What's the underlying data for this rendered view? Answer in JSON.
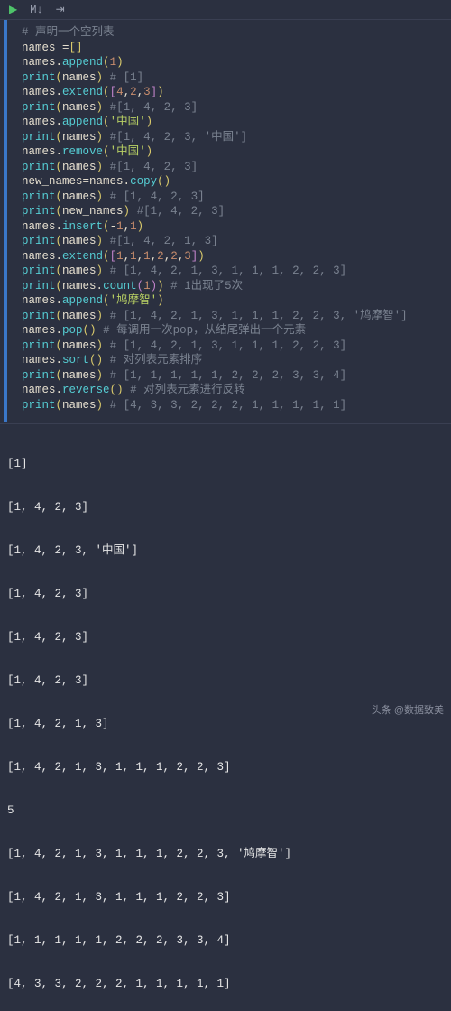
{
  "toolbar": {
    "run": "▶",
    "markdown": "M↓",
    "more": "⇥"
  },
  "code": {
    "l1": {
      "c": "# 声明一个空列表"
    },
    "l2": {
      "v1": "names ",
      "op": "=",
      "br1": "[",
      "br2": "]"
    },
    "l3": {
      "v1": "names",
      "dot": ".",
      "fn": "append",
      "p1": "(",
      "n1": "1",
      "p2": ")"
    },
    "l4": {
      "fn": "print",
      "p1": "(",
      "v1": "names",
      "p2": ")",
      "sp": " ",
      "c": "# [1]"
    },
    "l5": {
      "v1": "names",
      "dot": ".",
      "fn": "extend",
      "p1": "(",
      "b21": "[",
      "n1": "4",
      "c1": ",",
      "n2": "2",
      "c2": ",",
      "n3": "3",
      "b22": "]",
      "p2": ")"
    },
    "l6": {
      "fn": "print",
      "p1": "(",
      "v1": "names",
      "p2": ")",
      "sp": " ",
      "c": "#[1, 4, 2, 3]"
    },
    "l7": {
      "v1": "names",
      "dot": ".",
      "fn": "append",
      "p1": "(",
      "s1": "'中国'",
      "p2": ")"
    },
    "l8": {
      "fn": "print",
      "p1": "(",
      "v1": "names",
      "p2": ")",
      "sp": " ",
      "c": "#[1, 4, 2, 3, '中国']"
    },
    "l9": {
      "v1": "names",
      "dot": ".",
      "fn": "remove",
      "p1": "(",
      "s1": "'中国'",
      "p2": ")"
    },
    "l10": {
      "fn": "print",
      "p1": "(",
      "v1": "names",
      "p2": ")",
      "sp": " ",
      "c": "#[1, 4, 2, 3]"
    },
    "l11": {
      "v1": "new_names",
      "op": "=",
      "v2": "names",
      "dot": ".",
      "fn": "copy",
      "p1": "(",
      "p2": ")"
    },
    "l12": {
      "fn": "print",
      "p1": "(",
      "v1": "names",
      "p2": ")",
      "sp": " ",
      "c": "# [1, 4, 2, 3]"
    },
    "l13": {
      "fn": "print",
      "p1": "(",
      "v1": "new_names",
      "p2": ")",
      "sp": " ",
      "c": "#[1, 4, 2, 3]"
    },
    "l14": {
      "v1": "names",
      "dot": ".",
      "fn": "insert",
      "p1": "(",
      "op2": "-",
      "n1": "1",
      "c1": ",",
      "n2": "1",
      "p2": ")"
    },
    "l15": {
      "fn": "print",
      "p1": "(",
      "v1": "names",
      "p2": ")",
      "sp": " ",
      "c": "#[1, 4, 2, 1, 3]"
    },
    "l16": {
      "v1": "names",
      "dot": ".",
      "fn": "extend",
      "p1": "(",
      "b21": "[",
      "n1": "1",
      "c1": ",",
      "n2": "1",
      "c2": ",",
      "n3": "1",
      "c3": ",",
      "n4": "2",
      "c4": ",",
      "n5": "2",
      "c5": ",",
      "n6": "3",
      "b22": "]",
      "p2": ")"
    },
    "l17": {
      "fn": "print",
      "p1": "(",
      "v1": "names",
      "p2": ")",
      "sp": " ",
      "c": "# [1, 4, 2, 1, 3, 1, 1, 1, 2, 2, 3]"
    },
    "l18": {
      "fn": "print",
      "p1": "(",
      "v1": "names",
      "dot": ".",
      "fn2": "count",
      "b21": "(",
      "n1": "1",
      "b22": ")",
      "p2": ")",
      "sp": " ",
      "c": "# 1出现了5次"
    },
    "l19": {
      "v1": "names",
      "dot": ".",
      "fn": "append",
      "p1": "(",
      "s1": "'鸠摩智'",
      "p2": ")"
    },
    "l20": {
      "fn": "print",
      "p1": "(",
      "v1": "names",
      "p2": ")",
      "sp": " ",
      "c": "# [1, 4, 2, 1, 3, 1, 1, 1, 2, 2, 3, '鸠摩智']"
    },
    "l21": {
      "v1": "names",
      "dot": ".",
      "fn": "pop",
      "p1": "(",
      "p2": ")",
      "sp": " ",
      "c": "# 每调用一次pop，从结尾弹出一个元素"
    },
    "l22": {
      "fn": "print",
      "p1": "(",
      "v1": "names",
      "p2": ")",
      "sp": " ",
      "c": "# [1, 4, 2, 1, 3, 1, 1, 1, 2, 2, 3]"
    },
    "l23": {
      "v1": "names",
      "dot": ".",
      "fn": "sort",
      "p1": "(",
      "p2": ")",
      "sp": " ",
      "c": "# 对列表元素排序"
    },
    "l24": {
      "fn": "print",
      "p1": "(",
      "v1": "names",
      "p2": ")",
      "sp": " ",
      "c": "# [1, 1, 1, 1, 1, 2, 2, 2, 3, 3, 4]"
    },
    "l25": {
      "v1": "names",
      "dot": ".",
      "fn": "reverse",
      "p1": "(",
      "p2": ")",
      "sp": " ",
      "c": "# 对列表元素进行反转"
    },
    "l26": {
      "fn": "print",
      "p1": "(",
      "v1": "names",
      "p2": ")",
      "sp": " ",
      "c": "# [4, 3, 3, 2, 2, 2, 1, 1, 1, 1, 1]"
    }
  },
  "output": [
    "[1]",
    "[1, 4, 2, 3]",
    "[1, 4, 2, 3, '中国']",
    "[1, 4, 2, 3]",
    "[1, 4, 2, 3]",
    "[1, 4, 2, 3]",
    "[1, 4, 2, 1, 3]",
    "[1, 4, 2, 1, 3, 1, 1, 1, 2, 2, 3]",
    "5",
    "[1, 4, 2, 1, 3, 1, 1, 1, 2, 2, 3, '鸠摩智']",
    "[1, 4, 2, 1, 3, 1, 1, 1, 2, 2, 3]",
    "[1, 1, 1, 1, 1, 2, 2, 2, 3, 3, 4]",
    "[4, 3, 3, 2, 2, 2, 1, 1, 1, 1, 1]"
  ],
  "watermark": "头条 @数据致美"
}
